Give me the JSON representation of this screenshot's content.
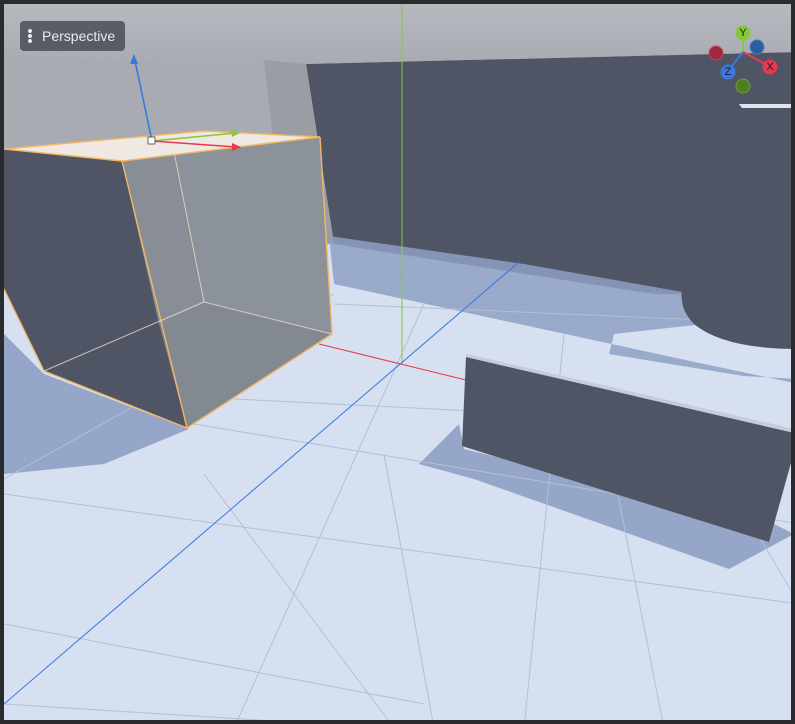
{
  "viewport": {
    "view_mode_label": "Perspective",
    "background_color": "#d6e0f0",
    "accent_colors": {
      "x_axis": "#e8394f",
      "y_axis": "#86c83a",
      "z_axis": "#3a78e0",
      "selection_outline": "#f3b764"
    },
    "menu_icon": "kebab-menu-icon"
  },
  "orientation_gizmo": {
    "x_label": "X",
    "y_label": "Y",
    "z_label": "Z"
  }
}
